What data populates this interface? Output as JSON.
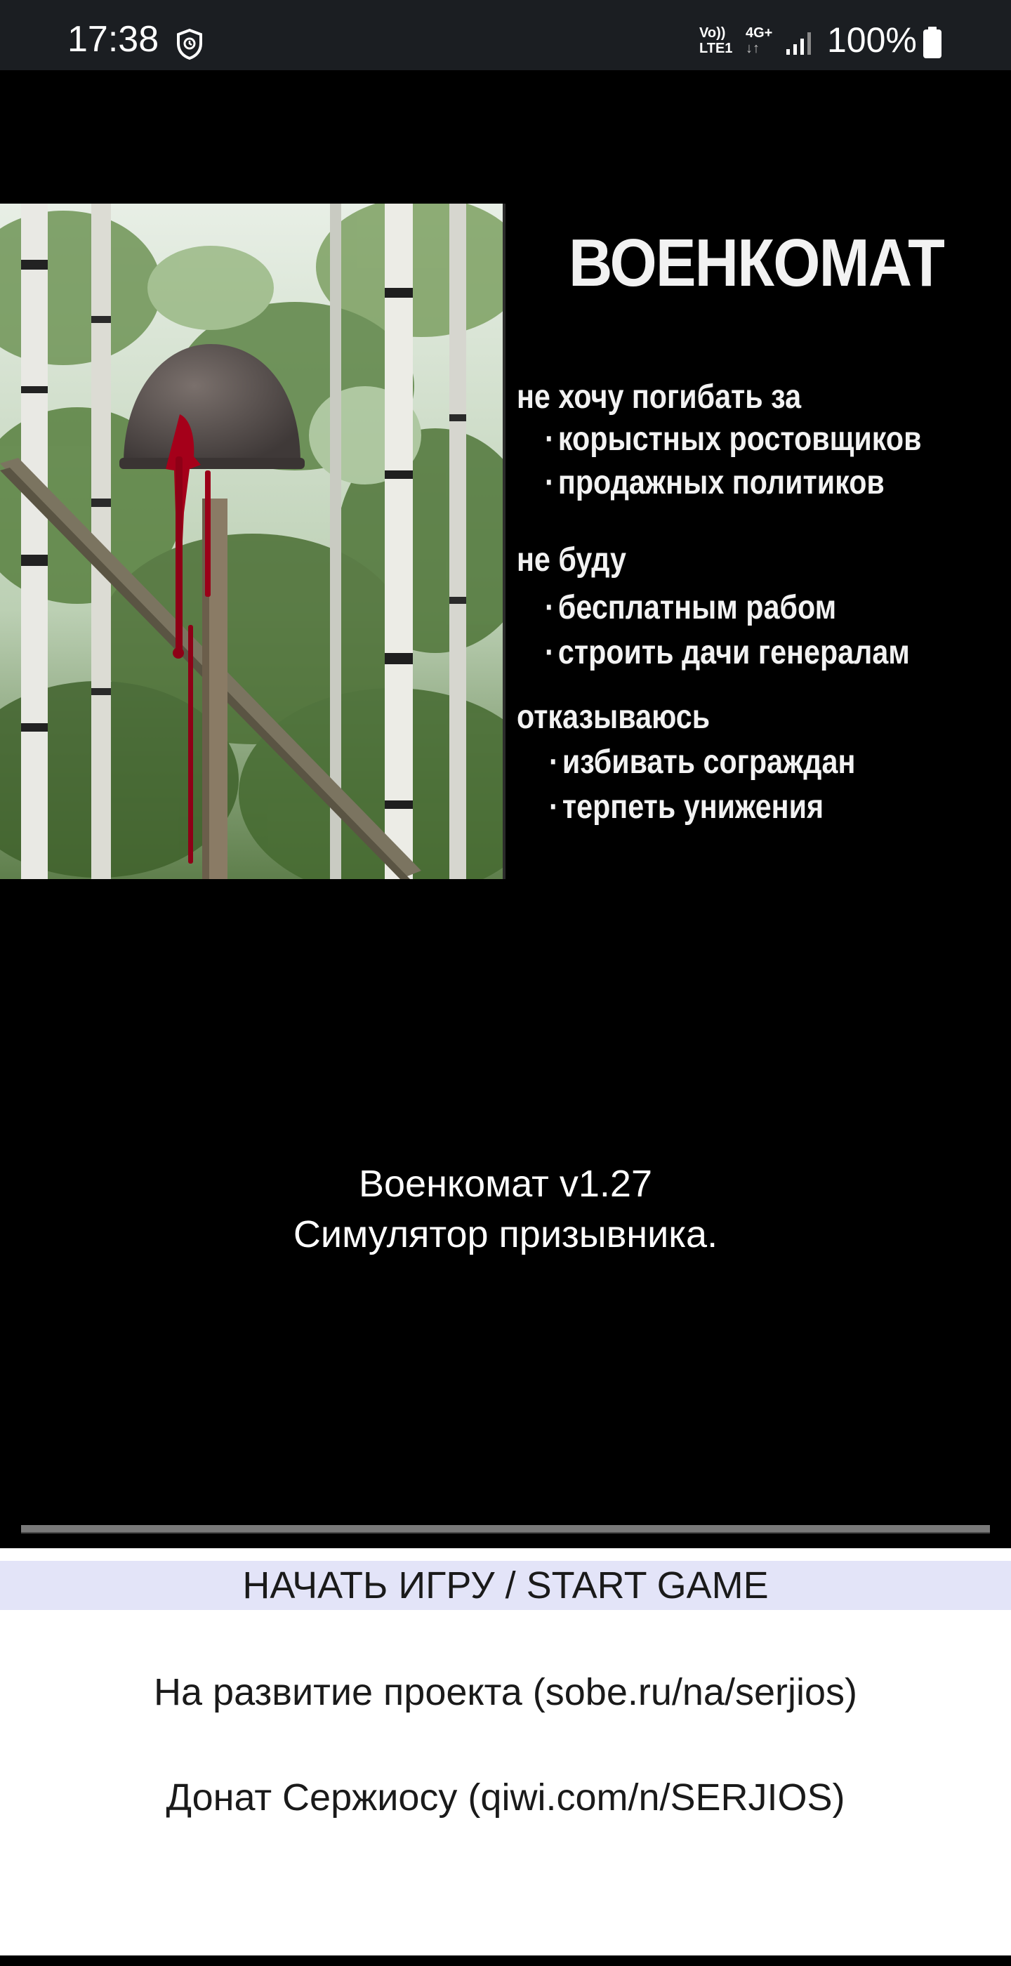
{
  "status_bar": {
    "time": "17:38",
    "volte_top": "Vo))",
    "volte_bottom": "LTE1",
    "network": "4G+",
    "battery": "100%",
    "icons": [
      "shield-icon",
      "volte-icon",
      "network-icon",
      "signal-icon",
      "battery-icon"
    ]
  },
  "banner": {
    "title": "ВОЕНКОМАТ",
    "sections": [
      {
        "heading": "не хочу погибать за",
        "items": [
          "корыстных ростовщиков",
          "продажных политиков"
        ]
      },
      {
        "heading": "не буду",
        "items": [
          "бесплатным рабом",
          "строить дачи генералам"
        ]
      },
      {
        "heading": "отказываюсь",
        "items": [
          "избивать сограждан",
          "терпеть унижения"
        ]
      }
    ],
    "bullet": "·"
  },
  "app_info": {
    "version_line": "Военкомат v1.27",
    "subtitle": "Симулятор призывника."
  },
  "actions": {
    "start_label": "НАЧАТЬ ИГРУ / START GAME",
    "sobe_link": "На развитие проекта (sobe.ru/na/serjios)",
    "qiwi_link": "Донат Сержиосу (qiwi.com/n/SERJIOS)"
  },
  "colors": {
    "background": "#000000",
    "status_bar": "#1b1e22",
    "panel": "#ffffff",
    "start_button_bg": "#e3e4f8",
    "divider": "#7a7a7a",
    "blood": "#a5001a"
  }
}
